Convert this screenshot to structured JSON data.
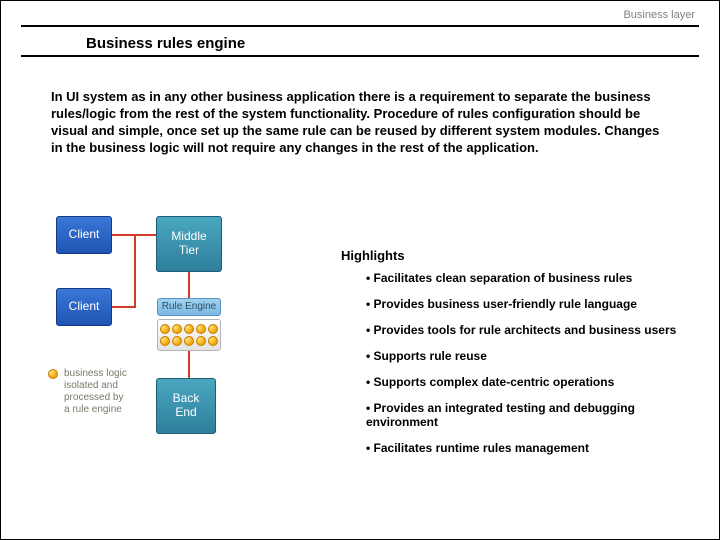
{
  "header": {
    "section": "Business layer"
  },
  "title": "Business rules engine",
  "paragraph": "In UI system as in any other business application there is a requirement to separate the business rules/logic from the rest of the system functionality. Procedure of rules configuration should be visual and simple, once  set up the same rule can be reused by different system modules. Changes in the business logic will not require any changes in the rest of the application.",
  "diagram": {
    "client1": "Client",
    "client2": "Client",
    "middle": "Middle\nTier",
    "rule_engine": "Rule Engine",
    "backend": "Back\nEnd",
    "legend": "business logic\nisolated and\nprocessed by\na rule engine"
  },
  "highlights": {
    "title": "Highlights",
    "items": [
      "• Facilitates clean separation of business rules",
      "• Provides business user-friendly rule language",
      "• Provides tools for rule architects and business users",
      "• Supports rule reuse",
      "• Supports complex date-centric operations",
      "• Provides an integrated testing and debugging environment",
      "• Facilitates runtime rules management"
    ]
  }
}
